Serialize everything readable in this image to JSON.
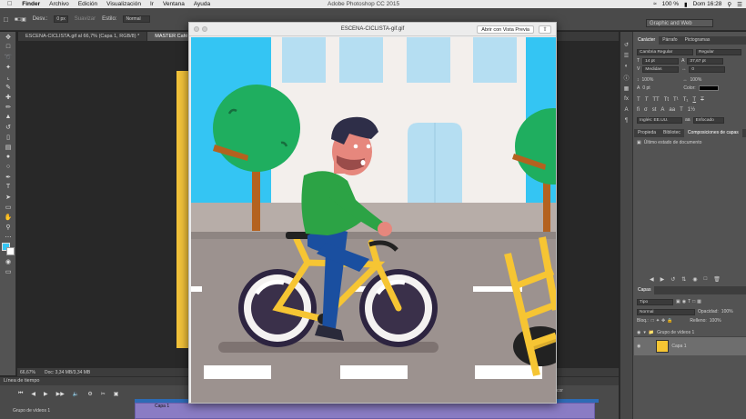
{
  "menubar": {
    "apple": "",
    "items": [
      "Finder",
      "Archivo",
      "Edición",
      "Visualización",
      "Ir",
      "Ventana",
      "Ayuda"
    ],
    "center_title": "Adobe Photoshop CC 2015",
    "battery": "100 %",
    "clock": "Dom 16:28"
  },
  "options": {
    "blur_label": "Desv.:",
    "blur_value": "0 px",
    "smooth": "Suavizar",
    "style_label": "Estilo:",
    "style_value": "Normal",
    "workspace": "Graphic and Web"
  },
  "doc_tabs": [
    {
      "label": "ESCENA-CICLISTA.gif al 66,7% (Capa 1, RGB/8) *",
      "active": false
    },
    {
      "label": "MASTER Café para to...",
      "active": true
    }
  ],
  "status": {
    "zoom": "66,67%",
    "doc": "Doc: 3,34 MB/3,34 MB"
  },
  "timeline": {
    "title": "Línea de tiempo",
    "track": "Grupo de vídeos 1",
    "clip": "Capa 1",
    "tail": "cor"
  },
  "viewer": {
    "title": "ESCENA-CICLISTA-gif.gif",
    "open_button": "Abrir con Vista Previa"
  },
  "character_panel": {
    "tabs": [
      "Carácter",
      "Párrafo",
      "Pictogramas"
    ],
    "font": "Cambria Regular",
    "style": "Regular",
    "size": "14 pt",
    "leading": "37,67 pt",
    "kerning": "Medidas",
    "tracking": "0",
    "vscale": "100%",
    "hscale": "100%",
    "baseline": "0 pt",
    "color_label": "Color:",
    "language": "Inglés: EE.UU.",
    "aa": "Enfocado"
  },
  "comps_panel": {
    "tabs": [
      "Propieda",
      "Bibliotec",
      "Composiciones de capas"
    ],
    "item": "Último estado de documento"
  },
  "layers_panel": {
    "tab": "Capas",
    "kind": "Tipo",
    "blend": "Normal",
    "opacity_label": "Opacidad:",
    "opacity": "100%",
    "lock_label": "Bloq.:",
    "fill_label": "Relleno:",
    "fill": "100%",
    "layers": [
      {
        "name": "Grupo de vídeos 1"
      },
      {
        "name": "Capa 1"
      }
    ]
  },
  "colors": {
    "sky": "#34c5f3",
    "building": "#f3efec",
    "window": "#b5def2",
    "tree": "#1fae5f",
    "trunk": "#b4621f",
    "road": "#9c928f",
    "sidewalk": "#b7ada8",
    "bike": "#f6c533",
    "shirt": "#2ca345",
    "pants": "#1a4fa0"
  }
}
